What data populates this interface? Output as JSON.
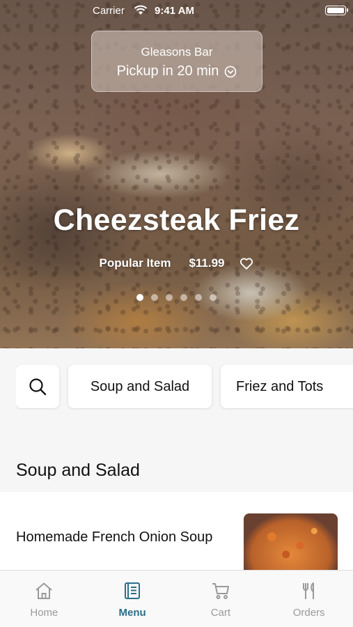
{
  "status_bar": {
    "carrier": "Carrier",
    "time": "9:41 AM"
  },
  "pickup": {
    "venue": "Gleasons Bar",
    "eta": "Pickup in 20 min"
  },
  "hero": {
    "title": "Cheezsteak Friez",
    "tag": "Popular Item",
    "price": "$11.99",
    "carousel": {
      "count": 6,
      "active_index": 0
    }
  },
  "categories": {
    "search_icon": "search-icon",
    "items": [
      "Soup and Salad",
      "Friez and Tots"
    ]
  },
  "section": {
    "title": "Soup and Salad"
  },
  "menu_items": [
    {
      "name": "Homemade French Onion Soup"
    }
  ],
  "tabbar": {
    "tabs": [
      {
        "label": "Home",
        "icon": "home-icon",
        "active": false
      },
      {
        "label": "Menu",
        "icon": "menu-book-icon",
        "active": true
      },
      {
        "label": "Cart",
        "icon": "cart-icon",
        "active": false
      },
      {
        "label": "Orders",
        "icon": "fork-knife-icon",
        "active": false
      }
    ],
    "active_color": "#2a6f8a",
    "inactive_color": "#9a9a9a"
  }
}
